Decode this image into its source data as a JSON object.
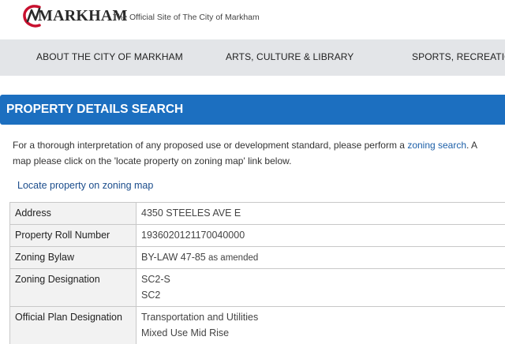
{
  "header": {
    "logo_text": "MARKHAM",
    "tagline": "The Official Site of The City of Markham"
  },
  "nav": {
    "items": [
      {
        "label": "ABOUT THE CITY OF MARKHAM"
      },
      {
        "label": "ARTS, CULTURE & LIBRARY"
      },
      {
        "label": "SPORTS, RECREATION"
      }
    ]
  },
  "page": {
    "title": "PROPERTY DETAILS SEARCH",
    "intro_line1_pre": "For a thorough interpretation of any proposed use or development standard, please perform a ",
    "intro_link": "zoning search",
    "intro_line1_post": ". A",
    "intro_line2": "map please click on the 'locate property on zoning map' link below.",
    "locate_link": "Locate property on zoning map"
  },
  "details": {
    "address": {
      "label": "Address",
      "value": "4350 STEELES AVE E"
    },
    "roll": {
      "label": "Property Roll Number",
      "value": "1936020121170040000"
    },
    "bylaw": {
      "label": "Zoning Bylaw",
      "value": "BY-LAW 47-85",
      "suffix": " as amended"
    },
    "zoning": {
      "label": "Zoning Designation",
      "value1": "SC2-S",
      "value2": "SC2"
    },
    "official": {
      "label": "Official Plan Designation",
      "value1": "Transportation and Utilities",
      "value2": "Mixed Use Mid Rise"
    }
  },
  "colors": {
    "banner": "#1c6fc0",
    "nav_bg": "#e3e5e8",
    "link": "#1c5fa8",
    "logo_red": "#c8102e"
  }
}
